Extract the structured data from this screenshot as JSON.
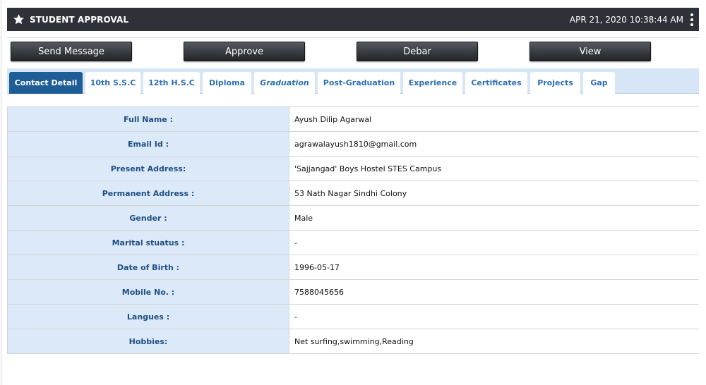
{
  "header": {
    "title": "STUDENT APPROVAL",
    "datetime": "APR 21, 2020  10:38:44 AM",
    "icon": "star-icon",
    "menu_icon": "kebab-menu-icon"
  },
  "actions": {
    "send_message": "Send Message",
    "approve": "Approve",
    "debar": "Debar",
    "view": "View"
  },
  "tabs": [
    {
      "label": "Contact Detail"
    },
    {
      "label": "10th S.S.C"
    },
    {
      "label": "12th H.S.C"
    },
    {
      "label": "Diploma"
    },
    {
      "label": "Graduation"
    },
    {
      "label": "Post-Graduation"
    },
    {
      "label": "Experience"
    },
    {
      "label": "Certificates"
    },
    {
      "label": "Projects"
    },
    {
      "label": "Gap"
    }
  ],
  "details": [
    {
      "label": "Full Name :",
      "value": "Ayush Dilip Agarwal"
    },
    {
      "label": "Email Id :",
      "value": "agrawalayush1810@gmail.com"
    },
    {
      "label": "Present Address:",
      "value": "'Sajjangad' Boys Hostel STES Campus"
    },
    {
      "label": "Permanent Address :",
      "value": "53 Nath Nagar Sindhi Colony"
    },
    {
      "label": "Gender :",
      "value": "Male"
    },
    {
      "label": "Marital stuatus :",
      "value": "-"
    },
    {
      "label": "Date of Birth :",
      "value": "1996-05-17"
    },
    {
      "label": "Mobile No. :",
      "value": "7588045656"
    },
    {
      "label": "Langues :",
      "value": "-"
    },
    {
      "label": "Hobbies:",
      "value": "Net surfing,swimming,Reading"
    }
  ],
  "colors": {
    "header_bg": "#2e3238",
    "tabbar_bg": "#d6e6f7",
    "active_tab": "#1f5d97",
    "tab_text": "#2c6fb3",
    "label_bg": "#dce9f9",
    "label_text": "#1f4f82"
  }
}
